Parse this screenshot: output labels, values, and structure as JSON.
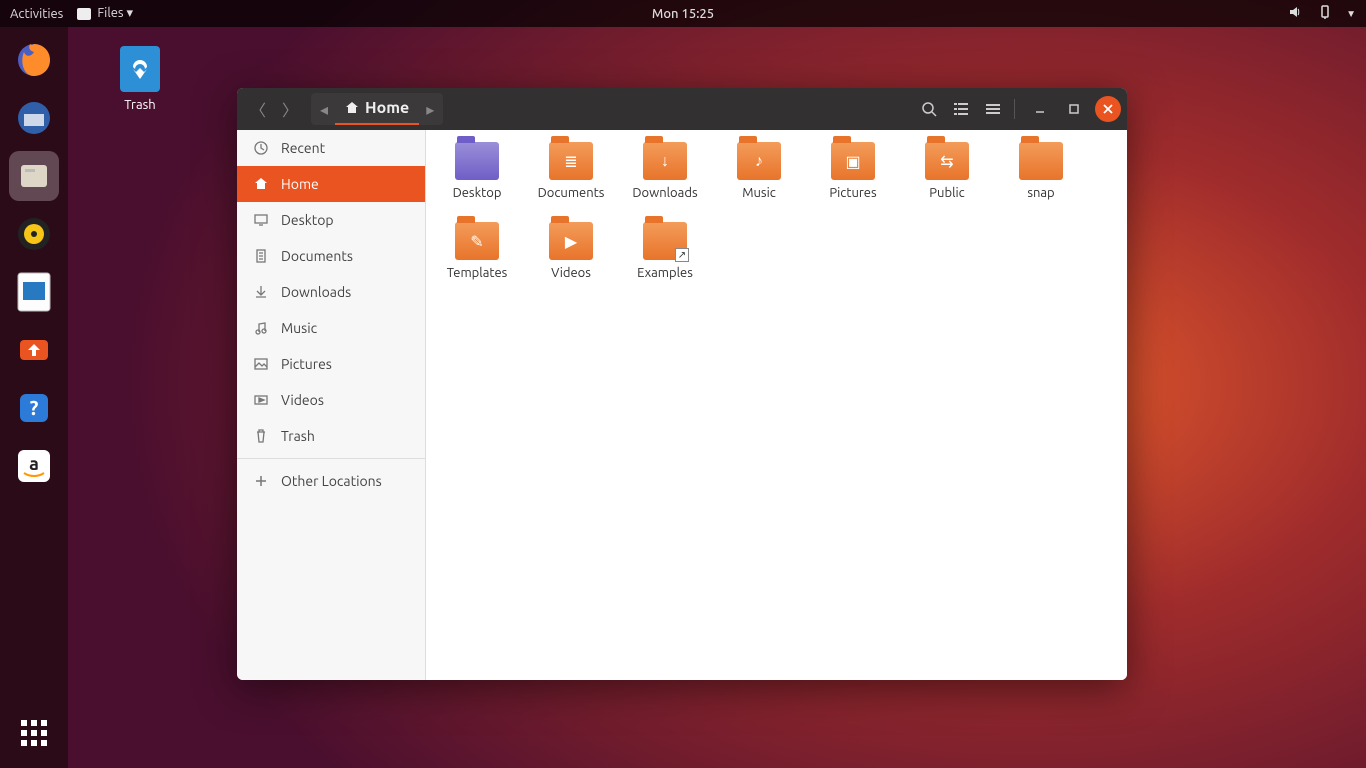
{
  "topbar": {
    "activities": "Activities",
    "app_indicator": "Files ▾",
    "clock": "Mon 15:25"
  },
  "desktop": {
    "trash_label": "Trash"
  },
  "dock": {
    "items": [
      {
        "name": "firefox"
      },
      {
        "name": "thunderbird"
      },
      {
        "name": "files"
      },
      {
        "name": "rhythmbox"
      },
      {
        "name": "libreoffice-writer"
      },
      {
        "name": "ubuntu-software"
      },
      {
        "name": "help"
      },
      {
        "name": "amazon"
      }
    ]
  },
  "window": {
    "path_current": "Home",
    "sidebar": [
      {
        "icon": "clock",
        "label": "Recent"
      },
      {
        "icon": "home",
        "label": "Home"
      },
      {
        "icon": "desktop",
        "label": "Desktop"
      },
      {
        "icon": "docs",
        "label": "Documents"
      },
      {
        "icon": "download",
        "label": "Downloads"
      },
      {
        "icon": "music",
        "label": "Music"
      },
      {
        "icon": "pictures",
        "label": "Pictures"
      },
      {
        "icon": "videos",
        "label": "Videos"
      },
      {
        "icon": "trash",
        "label": "Trash"
      }
    ],
    "other_locations": "Other Locations",
    "folders": [
      {
        "label": "Desktop",
        "variant": "desktop",
        "glyph": ""
      },
      {
        "label": "Documents",
        "glyph": "≣"
      },
      {
        "label": "Downloads",
        "glyph": "↓"
      },
      {
        "label": "Music",
        "glyph": "♪"
      },
      {
        "label": "Pictures",
        "glyph": "▣"
      },
      {
        "label": "Public",
        "glyph": "⇆"
      },
      {
        "label": "snap",
        "glyph": ""
      },
      {
        "label": "Templates",
        "glyph": "✎"
      },
      {
        "label": "Videos",
        "glyph": "▶"
      },
      {
        "label": "Examples",
        "glyph": "",
        "shortcut": true
      }
    ]
  }
}
